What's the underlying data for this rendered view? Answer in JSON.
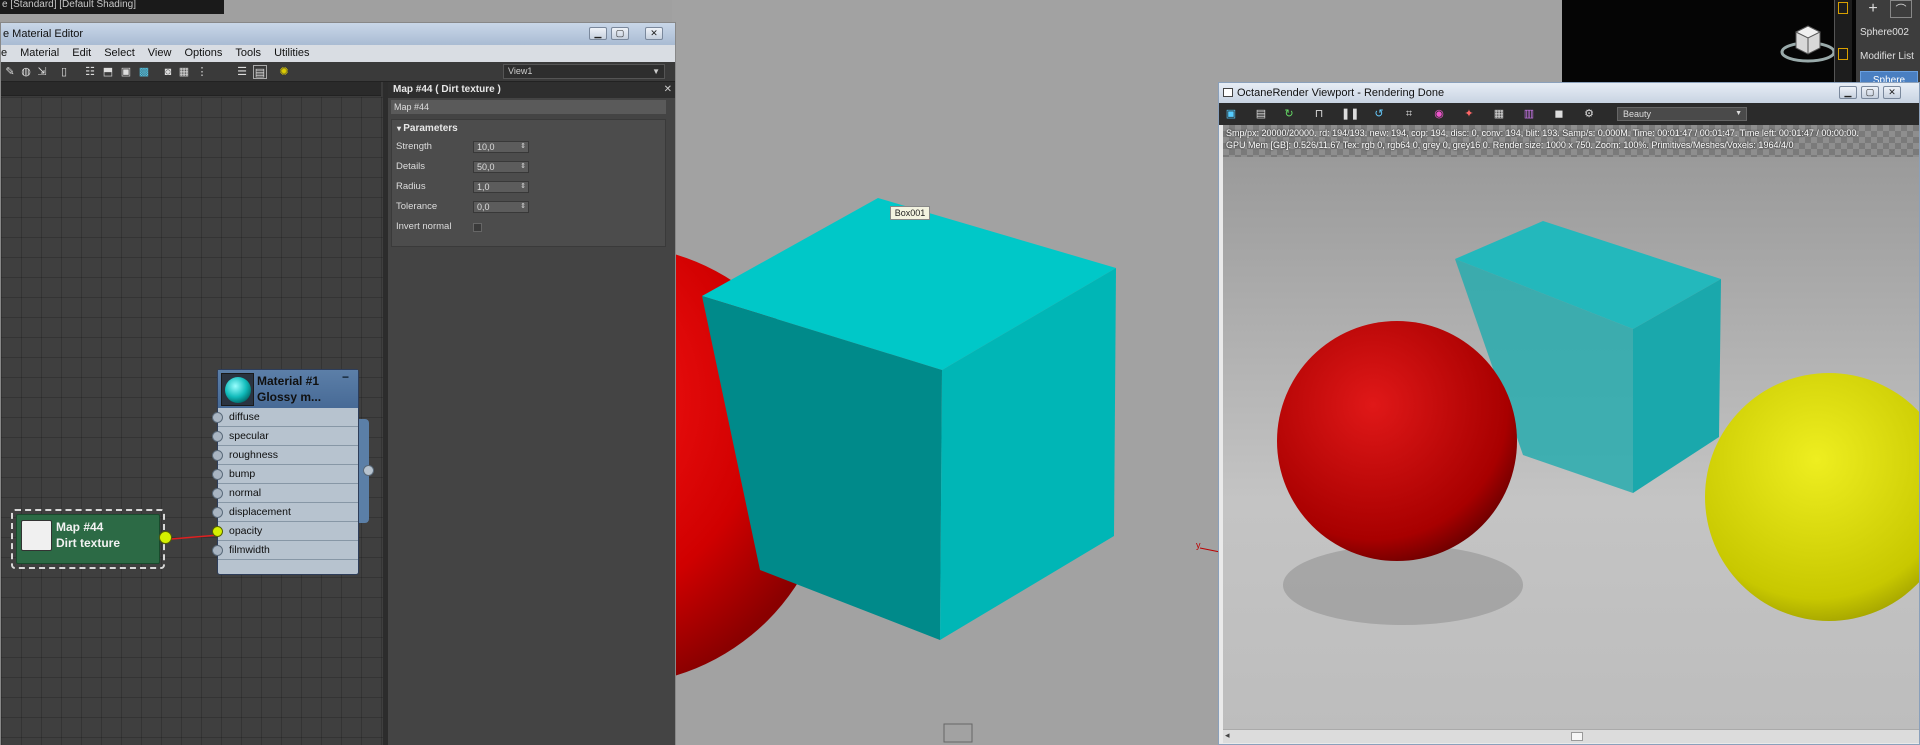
{
  "top_strip": {
    "text": "e [Standard] [Default Shading]"
  },
  "command_panel": {
    "add_icon": "plus-icon",
    "modify_icon": "curve-icon",
    "object_name": "Sphere002",
    "modifier_list": "Modifier List",
    "selected": "Sphere"
  },
  "viewport": {
    "box_label": "Box001",
    "axis_label": "y"
  },
  "material_editor": {
    "title": "e Material Editor",
    "menu": [
      "e",
      "Material",
      "Edit",
      "Select",
      "View",
      "Options",
      "Tools",
      "Utilities"
    ],
    "view_dropdown": "View1",
    "toolbar_icons": [
      "pick-material-icon",
      "get-material-icon",
      "assign-icon",
      "delete-icon",
      "layout-icon",
      "move-children-icon",
      "show-map-icon",
      "show-background-icon",
      "backlight-icon",
      "select-icon",
      "hierarchy-icon",
      "nav-icon",
      "pan-icon",
      "zoom-icon"
    ],
    "properties": {
      "title": "Map #44  ( Dirt texture )",
      "name_field": "Map #44",
      "rollout": "Parameters",
      "params": [
        {
          "label": "Strength",
          "value": "10,0",
          "type": "spinner"
        },
        {
          "label": "Details",
          "value": "50,0",
          "type": "spinner"
        },
        {
          "label": "Radius",
          "value": "1,0",
          "type": "spinner"
        },
        {
          "label": "Tolerance",
          "value": "0,0",
          "type": "spinner"
        },
        {
          "label": "Invert normal",
          "value": "",
          "type": "checkbox"
        }
      ]
    },
    "material_node": {
      "title_line1": "Material #1",
      "title_line2": "Glossy m...",
      "collapse": "−",
      "slots": [
        "diffuse",
        "specular",
        "roughness",
        "bump",
        "normal",
        "displacement",
        "opacity",
        "filmwidth"
      ],
      "connected_slot": "opacity"
    },
    "map_node": {
      "title_line1": "Map #44",
      "title_line2": "Dirt texture"
    }
  },
  "octane": {
    "title": "OctaneRender Viewport - Rendering Done",
    "pass_dropdown": "Beauty",
    "info_line1": "Smp/px: 20000/20000.   rd: 194/193.   new: 194, cop: 194, disc: 0, conv: 194, blit: 193.   Samp/s: 0.000M.   Time: 00:01:47 / 00:01:47.   Time left: 00:01:47 / 00:00:00.",
    "info_line2": "GPU Mem [GB]: 0.526/11.67   Tex: rgb 0, rgb64 0, grey 0, grey16 0.   Render size: 1000 x 750.   Zoom: 100%.   Primitives/Meshes/Voxels: 1964/4/0",
    "scroll_left": "◂"
  },
  "colors": {
    "sphere_red": "#d40000",
    "cube_cyan": "#00c3c3",
    "sphere_yellow": "#d8d800",
    "map_node_green": "#2c6a45",
    "material_node_blue": "#5c7fa8"
  }
}
